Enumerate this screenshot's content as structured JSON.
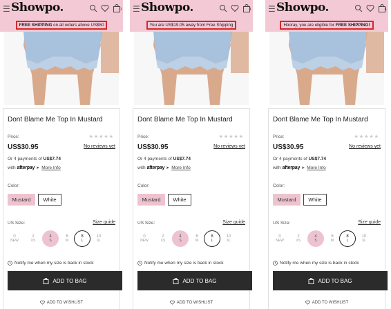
{
  "brand": "Showpo.",
  "bag_count": "0",
  "panels": [
    {
      "banner_parts": [
        {
          "text": "FREE SHIPPING",
          "bold": true
        },
        {
          "text": " on all orders above US$50",
          "bold": false
        }
      ],
      "banner_text": "FREE SHIPPING on all orders above US$50",
      "bag_count": "0"
    },
    {
      "banner_parts": [
        {
          "text": "You are US$19.05 away from Free Shipping",
          "bold": false
        }
      ],
      "banner_text": "You are US$19.05 away from Free Shipping",
      "bag_count": "1"
    },
    {
      "banner_parts": [
        {
          "text": "Hooray, you are eligible for ",
          "bold": false
        },
        {
          "text": "FREE SHIPPING!",
          "bold": true
        }
      ],
      "banner_text": "Hooray, you are eligible for FREE SHIPPING!",
      "bag_count": "1"
    }
  ],
  "product": {
    "title": "Dont Blame Me Top In Mustard",
    "price_label": "Price:",
    "price": "US$30.95",
    "reviews_link": "No reviews yet",
    "installments_prefix": "Or 4 payments of ",
    "installments_amount": "US$7.74",
    "with_label": "with",
    "afterpay_logo": "afterpay",
    "more_info": "More Info",
    "color_label": "Color:",
    "colors": [
      "Mustard",
      "White"
    ],
    "selected_color": "Mustard",
    "size_label": "US Size:",
    "size_guide": "Size guide",
    "sizes": [
      {
        "num": "0",
        "code": "NEW"
      },
      {
        "num": "2",
        "code": "XS"
      },
      {
        "num": "4",
        "code": "S"
      },
      {
        "num": "6",
        "code": "M"
      },
      {
        "num": "8",
        "code": "L"
      },
      {
        "num": "10",
        "code": "XL"
      }
    ],
    "selected_size": "4 S",
    "outlined_size": "8 L",
    "notify_text": "Notify me when my size is back in stock",
    "add_to_bag": "ADD TO BAG",
    "add_to_wishlist": "ADD TO WISHLIST"
  },
  "colors": {
    "header_pink": "#f3c9d6",
    "highlight_red": "#d32a2a",
    "swatch_pink": "#eec3d0",
    "button_dark": "#2b2b2b"
  }
}
